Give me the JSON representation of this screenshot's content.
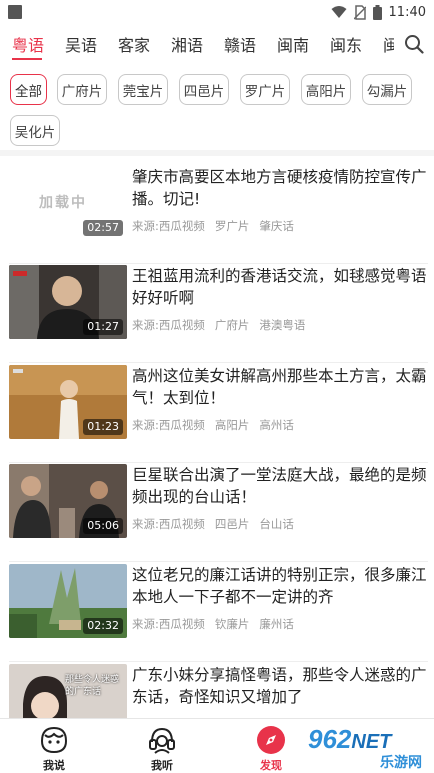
{
  "status_bar": {
    "time": "11:40",
    "icons": [
      "wifi-icon",
      "no-sim-icon",
      "battery-icon"
    ]
  },
  "tabs": [
    {
      "label": "粤语",
      "active": true
    },
    {
      "label": "吴语",
      "active": false
    },
    {
      "label": "客家",
      "active": false
    },
    {
      "label": "湘语",
      "active": false
    },
    {
      "label": "赣语",
      "active": false
    },
    {
      "label": "闽南",
      "active": false
    },
    {
      "label": "闽东",
      "active": false
    },
    {
      "label": "闽",
      "active": false
    }
  ],
  "chips": [
    {
      "label": "全部",
      "active": true
    },
    {
      "label": "广府片",
      "active": false
    },
    {
      "label": "莞宝片",
      "active": false
    },
    {
      "label": "四邑片",
      "active": false
    },
    {
      "label": "罗广片",
      "active": false
    },
    {
      "label": "高阳片",
      "active": false
    },
    {
      "label": "勾漏片",
      "active": false
    },
    {
      "label": "吴化片",
      "active": false
    }
  ],
  "videos": [
    {
      "title": "肇庆市高要区本地方言硬核疫情防控宣传广播。切记!",
      "duration": "02:57",
      "source": "来源:西瓜视频",
      "group": "罗广片",
      "dialect": "肇庆话",
      "thumb_text": "加载中"
    },
    {
      "title": "王祖蓝用流利的香港话交流，如毬感觉粤语好好听啊",
      "duration": "01:27",
      "source": "来源:西瓜视频",
      "group": "广府片",
      "dialect": "港澳粤语"
    },
    {
      "title": "高州这位美女讲解高州那些本土方言，太霸气！太到位！",
      "duration": "01:23",
      "source": "来源:西瓜视频",
      "group": "高阳片",
      "dialect": "高州话"
    },
    {
      "title": "巨星联合出演了一堂法庭大战，最绝的是频频出现的台山话！",
      "duration": "05:06",
      "source": "来源:西瓜视频",
      "group": "四邑片",
      "dialect": "台山话"
    },
    {
      "title": "这位老兄的廉江话讲的特别正宗，很多廉江本地人一下子都不一定讲的齐",
      "duration": "02:32",
      "source": "来源:西瓜视频",
      "group": "钦廉片",
      "dialect": "廉州话"
    },
    {
      "title": "广东小妹分享搞怪粤语，那些令人迷惑的广东话，奇怪知识又增加了",
      "duration": "",
      "source": "",
      "group": "",
      "dialect": "",
      "thumb_caption": "那些令人迷惑的广东话"
    }
  ],
  "bottom_nav": [
    {
      "label": "我说",
      "icon": "face-icon",
      "active": false
    },
    {
      "label": "我听",
      "icon": "headset-icon",
      "active": false
    },
    {
      "label": "发现",
      "icon": "compass-icon",
      "active": true
    }
  ],
  "watermark": {
    "brand": "962",
    "suffix": "NET",
    "sub": "乐游网"
  },
  "colors": {
    "accent": "#e8334a",
    "muted": "#999999"
  }
}
